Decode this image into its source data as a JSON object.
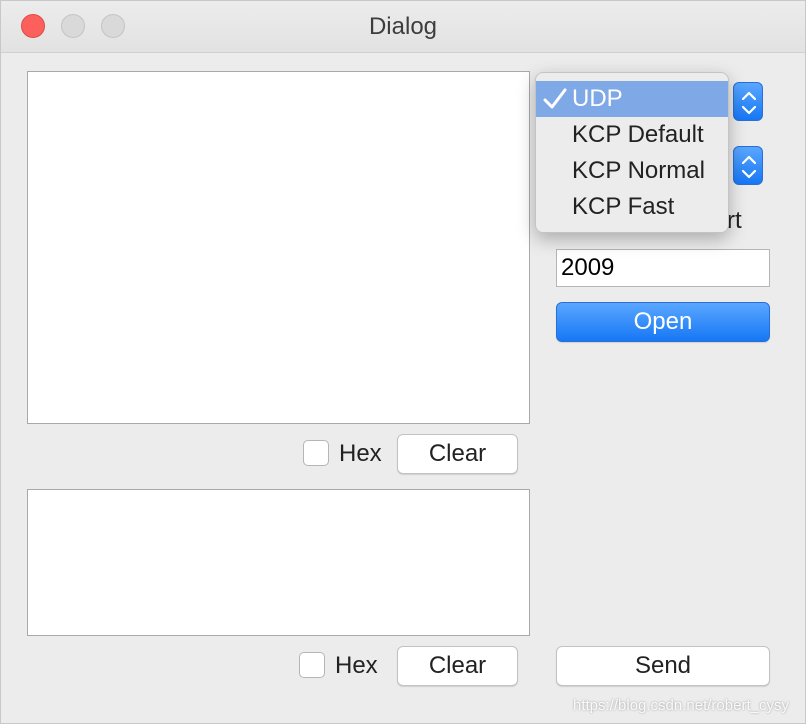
{
  "window": {
    "title": "Dialog"
  },
  "receive": {
    "hex_label": "Hex",
    "clear_label": "Clear"
  },
  "send_area": {
    "hex_label": "Hex",
    "clear_label": "Clear",
    "send_label": "Send"
  },
  "protocol_menu": {
    "items": [
      "UDP",
      "KCP Default",
      "KCP Normal",
      "KCP Fast"
    ],
    "selected": "UDP"
  },
  "port": {
    "label_partial": "rt",
    "value": "2009"
  },
  "open_button": {
    "label": "Open"
  },
  "watermark": {
    "text": "https://blog.csdn.net/robert_cysy"
  },
  "colors": {
    "accent": "#1677f5",
    "menu_highlight": "#7fa8e6",
    "close": "#fc605c"
  }
}
